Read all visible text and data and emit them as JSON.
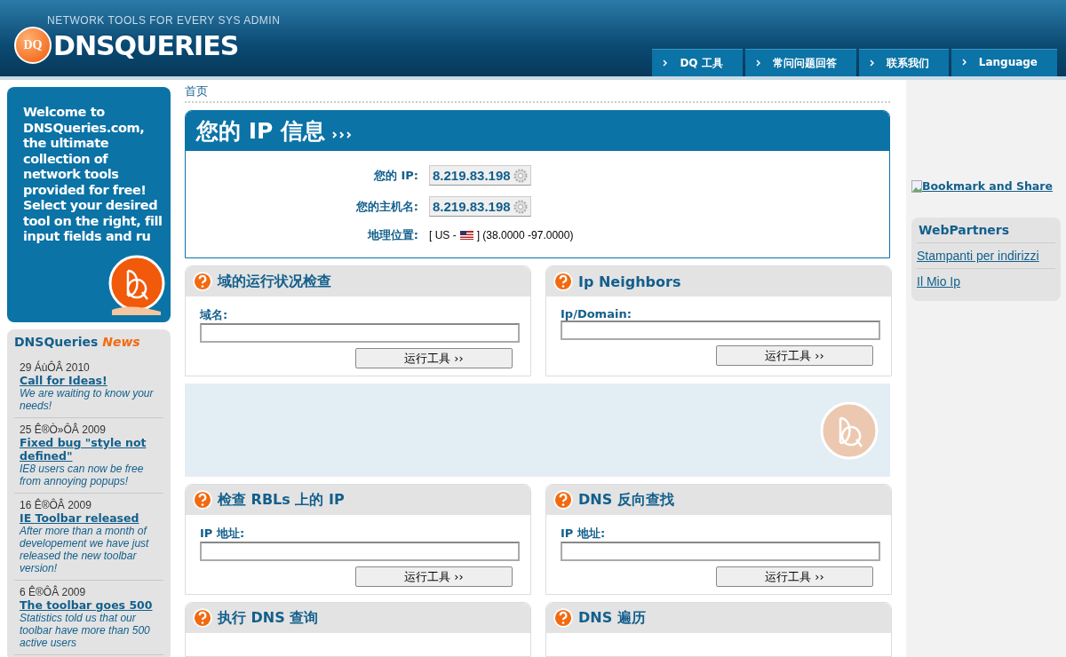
{
  "header": {
    "tagline": "NETWORK TOOLS FOR EVERY SYS ADMIN",
    "logo_mark": "DQ",
    "logo_text": "DNSQUERIES"
  },
  "nav": [
    {
      "label": "DQ 工具"
    },
    {
      "label": "常问问题回答"
    },
    {
      "label": "联系我们"
    },
    {
      "label": "Language"
    }
  ],
  "welcome": "Welcome to DNSQueries.com, the ultimate collection of network tools provided for free! Select your desired tool on the right, fill input fields and ru",
  "news": {
    "title": "DNSQueries",
    "title_accent": "News",
    "items": [
      {
        "date": "29 ÁùÔÂ 2010",
        "title": "Call for Ideas!",
        "text": "We are waiting to know your needs!"
      },
      {
        "date": "25 Ê®Ò»ÔÂ 2009",
        "title": "Fixed bug \"style not defined\"",
        "text": "IE8 users can now be free from annoying popups!"
      },
      {
        "date": "16 Ê®ÔÂ 2009",
        "title": "IE Toolbar released",
        "text": "After more than a month of developement we have just released the new toolbar version!"
      },
      {
        "date": "6 Ê®ÔÂ 2009",
        "title": "The toolbar goes 500",
        "text": "Statistics told us that our toolbar have more than 500 active users"
      }
    ]
  },
  "breadcrumb": "首页",
  "ip_info": {
    "title": "您的 IP 信息",
    "rows": [
      {
        "kind": "box",
        "label": "您的 IP:",
        "value": "8.219.83.198"
      },
      {
        "kind": "box",
        "label": "您的主机名:",
        "value": "8.219.83.198"
      },
      {
        "kind": "geo",
        "label": "地理位置:",
        "value": "[ US -",
        "value_end": "] (38.0000 -97.0000)"
      }
    ]
  },
  "tools_top": [
    {
      "title": "域的运行状况检查",
      "field_label": "域名:",
      "button": "运行工具 ››"
    },
    {
      "title": "Ip Neighbors",
      "field_label": "Ip/Domain:",
      "button": "运行工具 ››"
    }
  ],
  "tools_bottom": [
    {
      "title": "检查 RBLs 上的 IP",
      "field_label": "IP 地址:",
      "button": "运行工具 ››"
    },
    {
      "title": "DNS 反向查找",
      "field_label": "IP 地址:",
      "button": "运行工具 ››"
    }
  ],
  "tools_cut": [
    {
      "title": "执行 DNS 查询"
    },
    {
      "title": "DNS 遍历"
    }
  ],
  "sidebar": {
    "bookmark": "Bookmark and Share",
    "partners_title": "WebPartners",
    "partners": [
      "Stampanti per indirizzi",
      "Il Mio Ip"
    ]
  }
}
